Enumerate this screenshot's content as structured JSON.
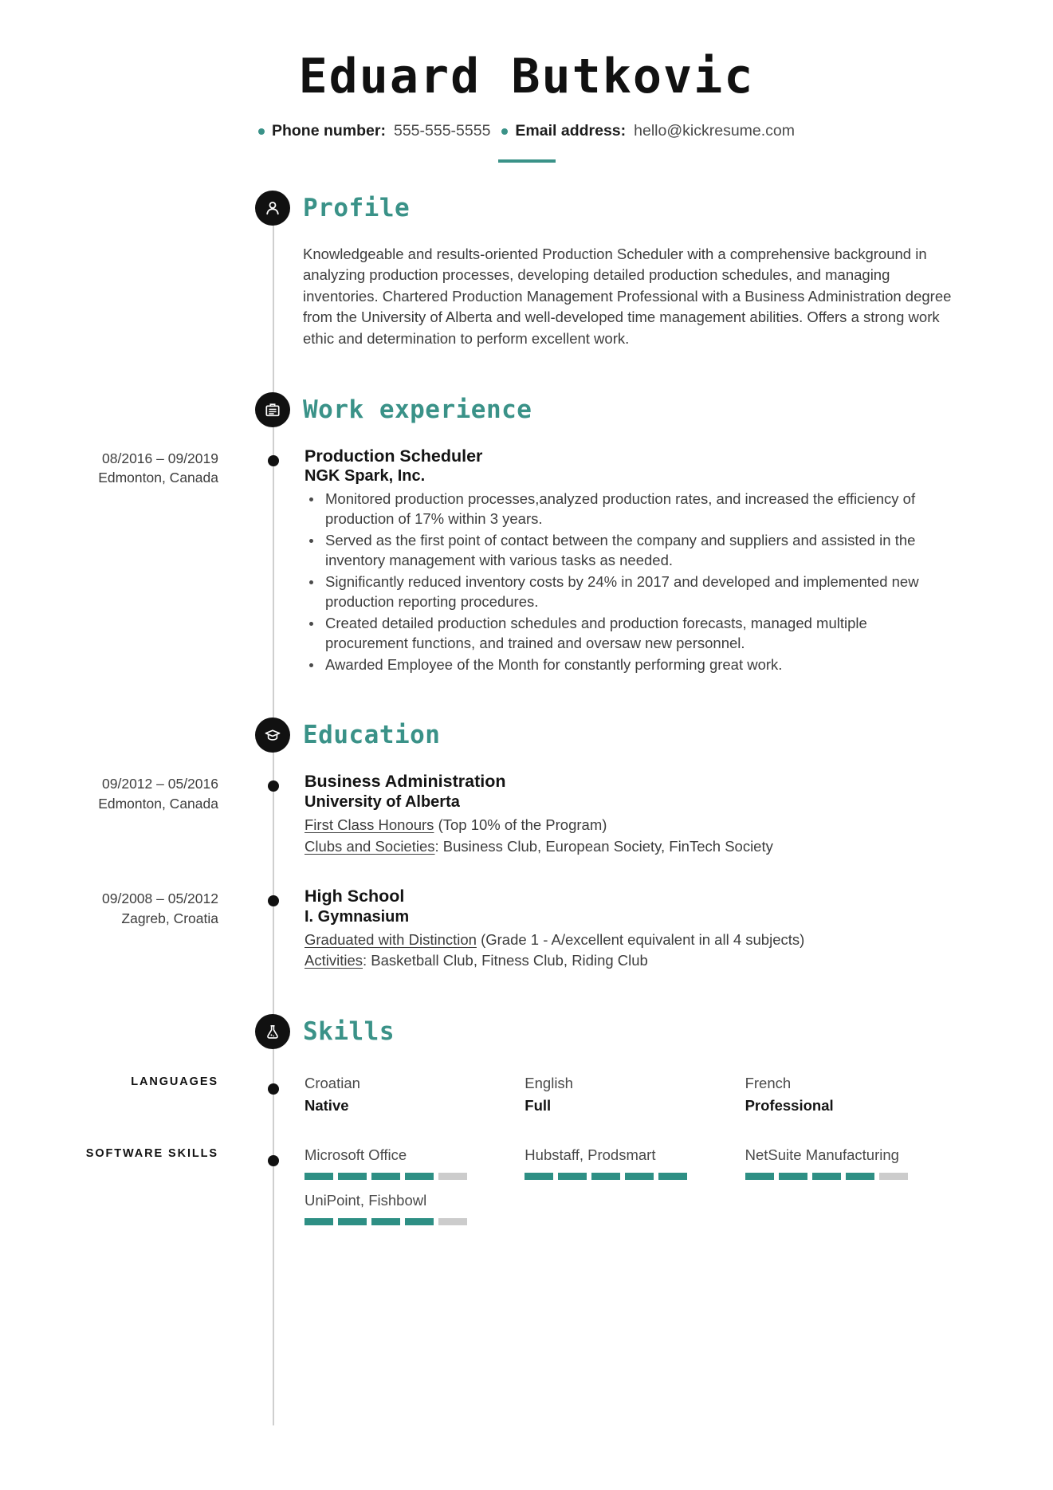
{
  "header": {
    "full_name": "Eduard Butkovic",
    "contacts": [
      {
        "label": "Phone number:",
        "value": "555-555-5555",
        "icon": "bullet-dot-icon"
      },
      {
        "label": "Email address:",
        "value": "hello@kickresume.com",
        "icon": "bullet-dot-icon"
      }
    ]
  },
  "theme": {
    "accent": "#3a9288",
    "rating_on": "#2e8f84",
    "rating_off": "#cccccc",
    "icon_bg": "#111111"
  },
  "sections": {
    "profile": {
      "title": "Profile",
      "icon": "person-icon",
      "text": "Knowledgeable and results-oriented Production Scheduler with a comprehensive background in analyzing production processes, developing detailed production schedules, and managing inventories. Chartered Production Management Professional with a Business Administration degree from the University of Alberta and well-developed time management abilities. Offers a strong work ethic and determination to perform excellent work."
    },
    "work": {
      "title": "Work experience",
      "icon": "briefcase-icon",
      "entries": [
        {
          "dates": "08/2016 – 09/2019",
          "location": "Edmonton, Canada",
          "job_title": "Production Scheduler",
          "company": "NGK Spark, Inc.",
          "bullets": [
            "Monitored production processes,analyzed production rates, and increased the efficiency of production of 17% within 3 years.",
            "Served as the first point of contact between the company and suppliers and assisted in the inventory management with various tasks as needed.",
            "Significantly reduced inventory costs by 24% in 2017 and developed and implemented new production reporting procedures.",
            "Created detailed production schedules and production forecasts, managed multiple procurement functions, and trained and oversaw new personnel.",
            "Awarded Employee of the Month for constantly performing great work."
          ]
        }
      ]
    },
    "education": {
      "title": "Education",
      "icon": "graduation-cap-icon",
      "entries": [
        {
          "dates": "09/2012 – 05/2016",
          "location": "Edmonton, Canada",
          "degree": "Business Administration",
          "school": "University of Alberta",
          "detail_1_underlined": "First Class Honours",
          "detail_1_rest": " (Top 10% of the Program)",
          "detail_2_underlined": "Clubs and Societies",
          "detail_2_rest": ": Business Club, European Society, FinTech Society"
        },
        {
          "dates": "09/2008 – 05/2012",
          "location": "Zagreb, Croatia",
          "degree": "High School",
          "school": "I. Gymnasium",
          "detail_1_underlined": "Graduated with Distinction",
          "detail_1_rest": " (Grade 1 - A/excellent equivalent in all 4 subjects)",
          "detail_2_underlined": "Activities",
          "detail_2_rest": ": Basketball Club, Fitness Club, Riding Club"
        }
      ]
    },
    "skills": {
      "title": "Skills",
      "icon": "flask-icon",
      "languages": {
        "label": "LANGUAGES",
        "items": [
          {
            "name": "Croatian",
            "level": "Native"
          },
          {
            "name": "English",
            "level": "Full"
          },
          {
            "name": "French",
            "level": "Professional"
          }
        ]
      },
      "software": {
        "label": "SOFTWARE SKILLS",
        "max_segments": 5,
        "items": [
          {
            "name": "Microsoft Office",
            "filled": 4
          },
          {
            "name": "Hubstaff, Prodsmart",
            "filled": 5
          },
          {
            "name": "NetSuite Manufacturing",
            "filled": 4
          },
          {
            "name": "UniPoint, Fishbowl",
            "filled": 4
          }
        ]
      }
    }
  }
}
